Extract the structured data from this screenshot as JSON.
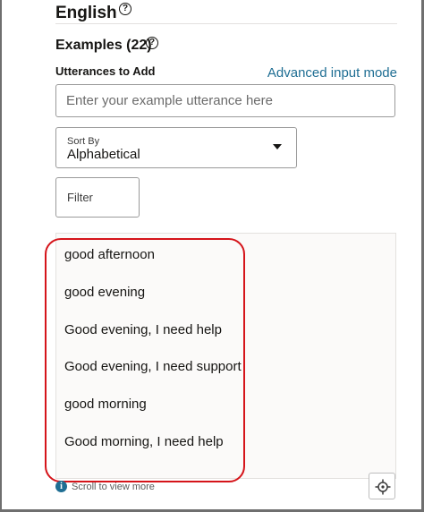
{
  "language": {
    "title": "English"
  },
  "examples": {
    "title": "Examples (22)"
  },
  "utterances": {
    "label": "Utterances to Add",
    "advanced_link": "Advanced input mode",
    "placeholder": "Enter your example utterance here"
  },
  "sort": {
    "label": "Sort By",
    "value": "Alphabetical"
  },
  "filter": {
    "label": "Filter"
  },
  "list": {
    "items": [
      "good afternoon",
      "good evening",
      "Good evening, I need help",
      "Good evening, I need support",
      "good morning",
      "Good morning, I need help"
    ]
  },
  "footer": {
    "scroll_note": "Scroll to view more"
  },
  "icons": {
    "help": "question-circle-icon",
    "info": "info-icon",
    "sort_caret": "caret-down-icon",
    "locate": "crosshair-icon"
  },
  "colors": {
    "link": "#1f6e93",
    "highlight": "#d5141a",
    "info": "#1f6e93"
  }
}
